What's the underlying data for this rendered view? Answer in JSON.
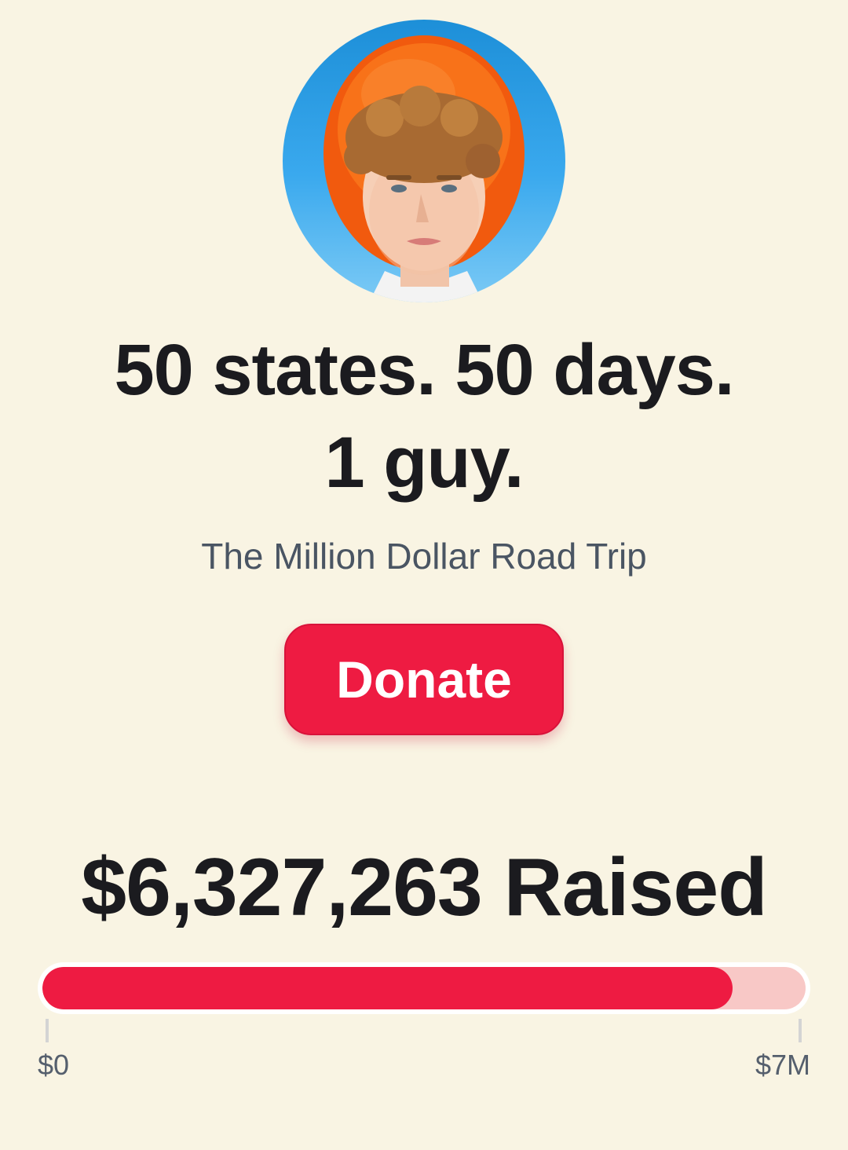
{
  "profile": {
    "avatar_alt": "Profile photo of a young man with curly hair wearing an orange hat"
  },
  "hero": {
    "headline_line1": "50 states. 50 days.",
    "headline_line2": "1 guy.",
    "subtitle": "The Million Dollar Road Trip"
  },
  "actions": {
    "donate_label": "Donate"
  },
  "fundraiser": {
    "raised_text": "$6,327,263 Raised",
    "raised_amount": 6327263,
    "goal_amount": 7000000,
    "progress_fraction": 0.9039,
    "min_label": "$0",
    "max_label": "$7M"
  },
  "colors": {
    "background": "#f9f4e3",
    "accent": "#ee1b42",
    "track": "#f8c8c6",
    "text_primary": "#1b1b1f",
    "text_secondary": "#4a5563"
  }
}
